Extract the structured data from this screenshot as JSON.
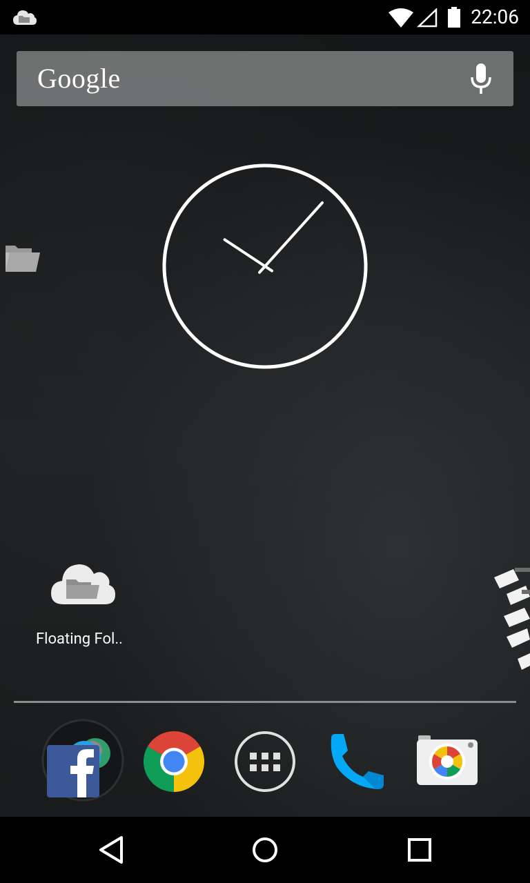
{
  "status_bar": {
    "time": "22:06",
    "icons": [
      "cloud-folder-icon",
      "wifi-icon",
      "signal-icon",
      "battery-icon"
    ]
  },
  "search_widget": {
    "logo_text": "Google",
    "mic_icon": "mic-icon"
  },
  "clock_widget": {
    "type": "analog",
    "hour": 10,
    "minute": 7
  },
  "home_screen": {
    "side_folder_icon": "folder-icon",
    "shortcuts": [
      {
        "label": "Floating Fol..",
        "icon": "cloud-folder-icon"
      }
    ]
  },
  "dock": {
    "apps": [
      {
        "name": "Facebook",
        "icon": "facebook-folder-icon"
      },
      {
        "name": "Chrome",
        "icon": "chrome-icon"
      },
      {
        "name": "Apps",
        "icon": "app-drawer-icon"
      },
      {
        "name": "Phone",
        "icon": "phone-icon"
      },
      {
        "name": "Camera",
        "icon": "camera-icon"
      }
    ]
  },
  "nav_bar": {
    "buttons": [
      "back-icon",
      "home-icon",
      "recents-icon"
    ]
  },
  "colors": {
    "status_bar": "#000000",
    "nav_bar": "#000000",
    "phone_blue": "#03A9F4",
    "chrome_red": "#DB4437",
    "chrome_yellow": "#F4C20D",
    "chrome_green": "#0F9D58",
    "chrome_blue": "#4285F4",
    "facebook_blue": "#3B5998"
  }
}
